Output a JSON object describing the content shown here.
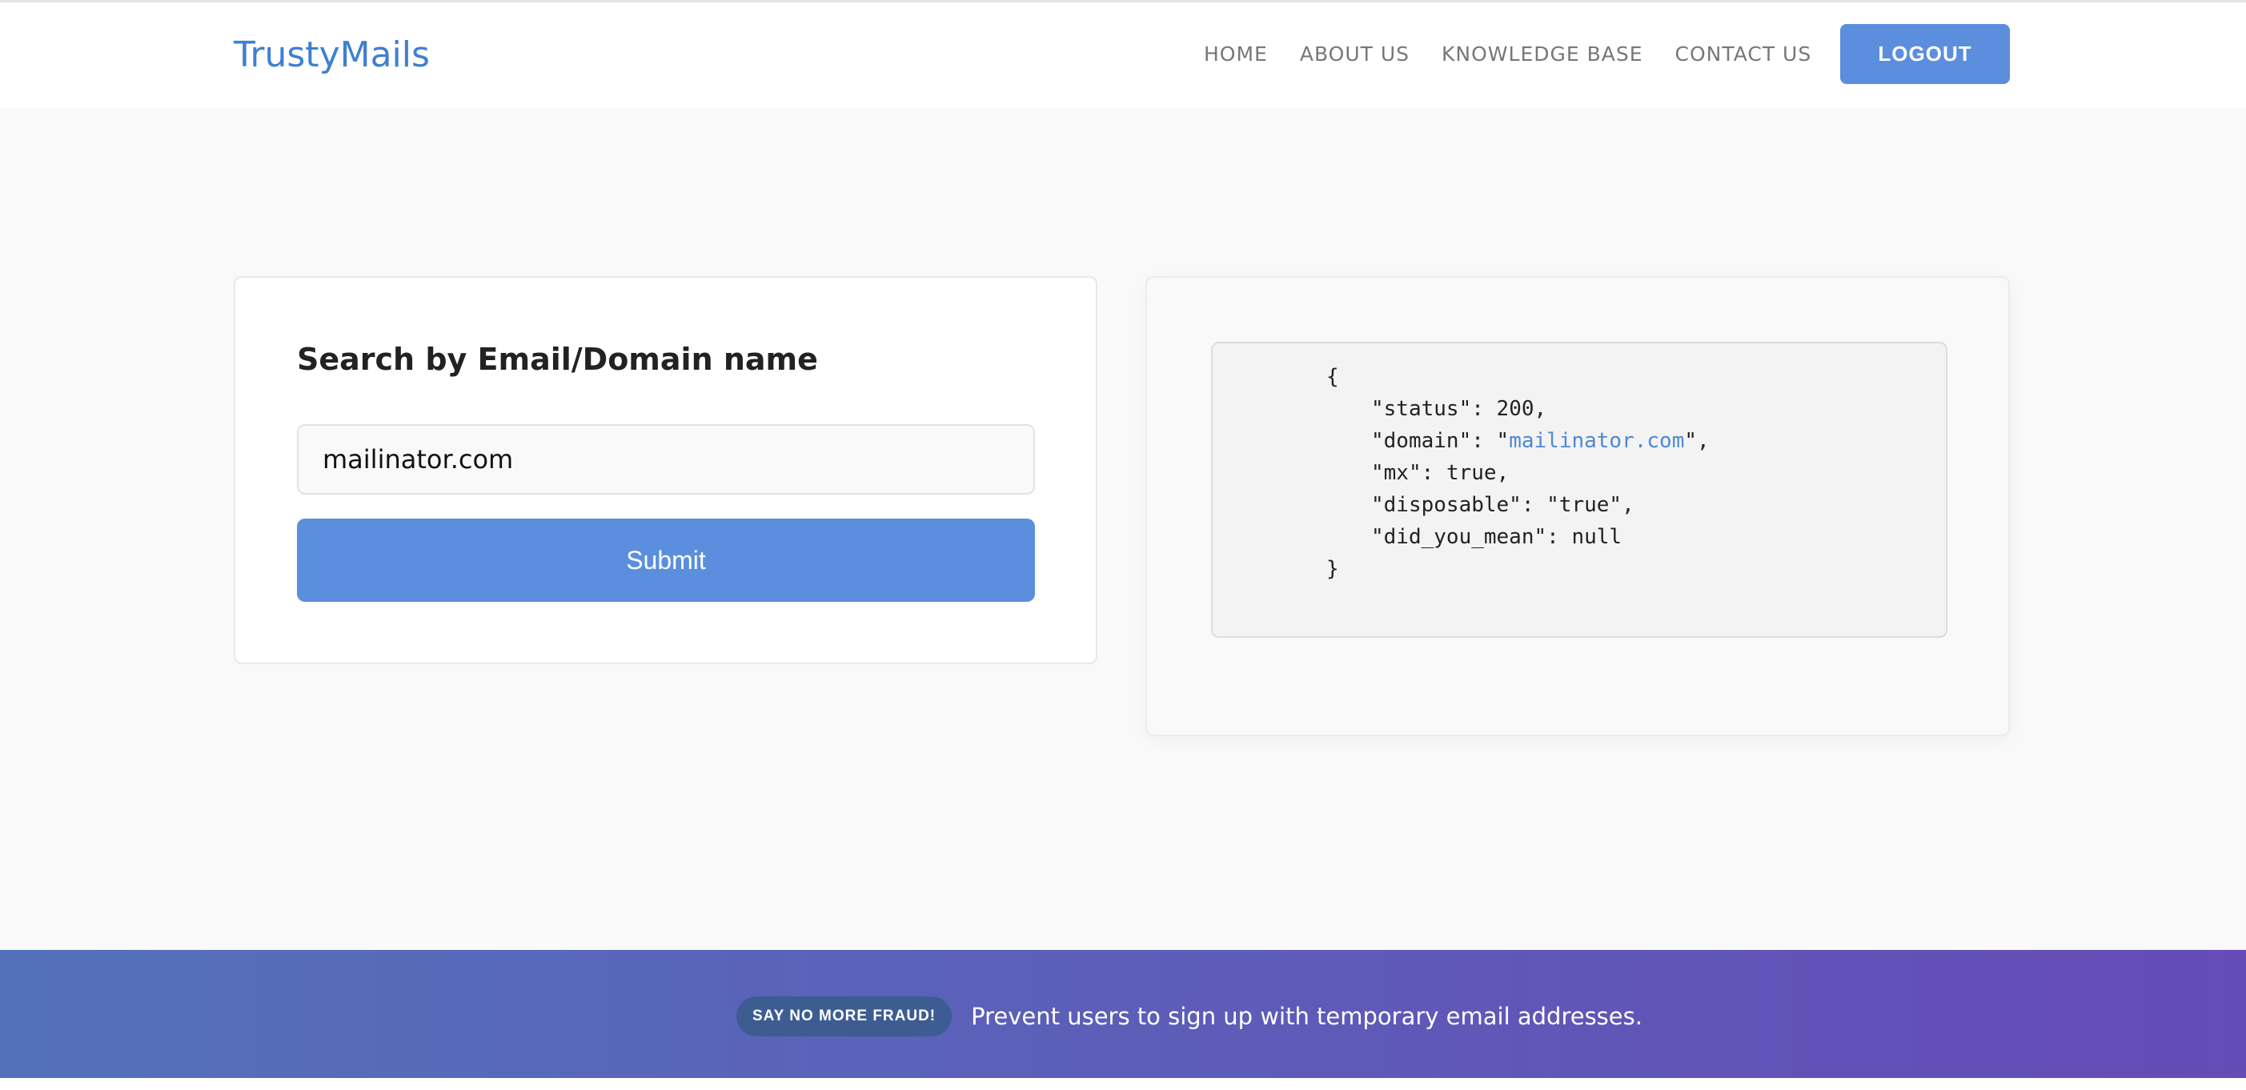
{
  "header": {
    "brand": "TrustyMails",
    "nav": [
      {
        "label": "HOME"
      },
      {
        "label": "ABOUT US"
      },
      {
        "label": "KNOWLEDGE BASE"
      },
      {
        "label": "CONTACT US"
      }
    ],
    "logout_label": "LOGOUT"
  },
  "search": {
    "title": "Search by Email/Domain name",
    "value": "mailinator.com",
    "submit_label": "Submit"
  },
  "result": {
    "open_brace": "{",
    "status_key": "\"status\"",
    "status_value": "200",
    "domain_key": "\"domain\"",
    "domain_value": "mailinator.com",
    "mx_key": "\"mx\"",
    "mx_value": "true",
    "disposable_key": "\"disposable\"",
    "disposable_value": "\"true\"",
    "did_you_mean_key": "\"did_you_mean\"",
    "did_you_mean_value": "null",
    "close_brace": "}"
  },
  "footer": {
    "badge": "SAY NO MORE FRAUD!",
    "text": "Prevent users to sign up with temporary email addresses."
  },
  "colors": {
    "brand": "#3f7fd1",
    "primary_button": "#5b8fdd",
    "link": "#4f87d6",
    "footer_gradient_start": "#5371bb",
    "footer_gradient_end": "#654bb6",
    "badge_bg": "#3d5d92"
  }
}
